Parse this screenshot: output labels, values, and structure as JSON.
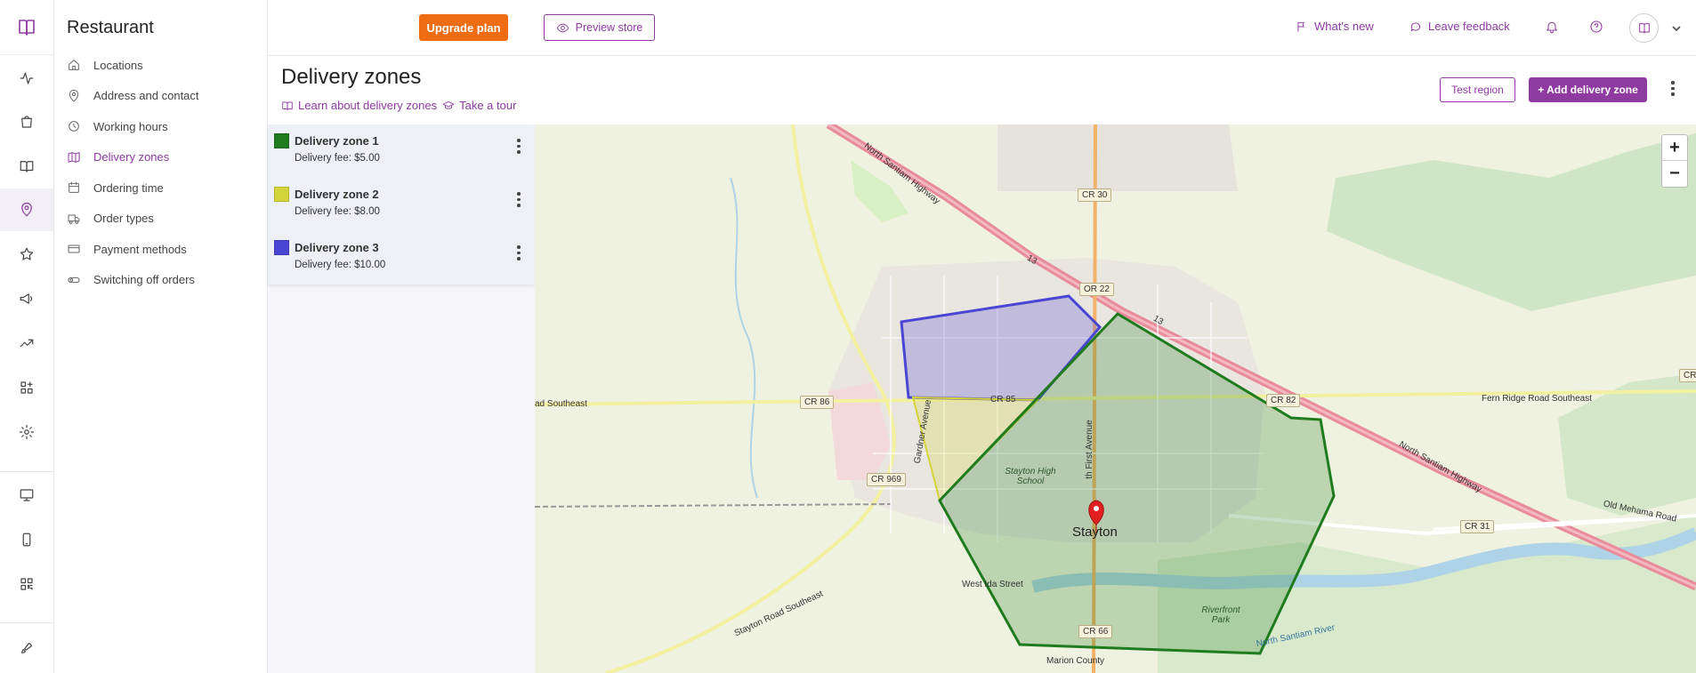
{
  "app": {
    "name": "Restaurant"
  },
  "sidebar": {
    "items": [
      {
        "label": "Locations"
      },
      {
        "label": "Address and contact"
      },
      {
        "label": "Working hours"
      },
      {
        "label": "Delivery zones"
      },
      {
        "label": "Ordering time"
      },
      {
        "label": "Order types"
      },
      {
        "label": "Payment methods"
      },
      {
        "label": "Switching off orders"
      }
    ],
    "active_label": "Delivery zones"
  },
  "topbar": {
    "upgrade_label": "Upgrade plan",
    "preview_label": "Preview store",
    "whats_new_label": "What's new",
    "feedback_label": "Leave feedback"
  },
  "page": {
    "title": "Delivery zones",
    "learn_link": "Learn about delivery zones",
    "tour_link": "Take a tour",
    "test_region_label": "Test region",
    "add_zone_label": "+ Add delivery zone"
  },
  "zones": [
    {
      "name": "Delivery zone 1",
      "fee": "Delivery fee: $5.00",
      "color": "#1e7b1e"
    },
    {
      "name": "Delivery zone 2",
      "fee": "Delivery fee: $8.00",
      "color": "#d4d43a"
    },
    {
      "name": "Delivery zone 3",
      "fee": "Delivery fee: $10.00",
      "color": "#4a45d2"
    }
  ],
  "map": {
    "city": "Stayton",
    "roads": {
      "north_santiam_hwy_1": "North Santiam Highway",
      "north_santiam_hwy_2": "North Santiam Highway",
      "cr30": "CR 30",
      "or22": "OR 22",
      "cr86": "CR 86",
      "cr85": "CR 85",
      "cr82": "CR 82",
      "cr969": "CR 969",
      "cr31": "CR 31",
      "cr66": "CR 66",
      "cr_edge": "CR",
      "thirteen_1": "13",
      "thirteen_2": "13",
      "southeast": "ad Southeast",
      "fern_ridge": "Fern Ridge Road Southeast",
      "old_mehama": "Old Mehama Road",
      "gardner": "Gardner Avenue",
      "first_ave": "th First Avenue",
      "west_ida": "West Ida Street",
      "stayton_road": "Stayton Road Southeast",
      "marion": "Marion County",
      "river": "North Santiam River"
    },
    "places": {
      "high_school": "Stayton High School",
      "riverfront": "Riverfront Park"
    },
    "zoom_in": "+",
    "zoom_out": "−"
  }
}
